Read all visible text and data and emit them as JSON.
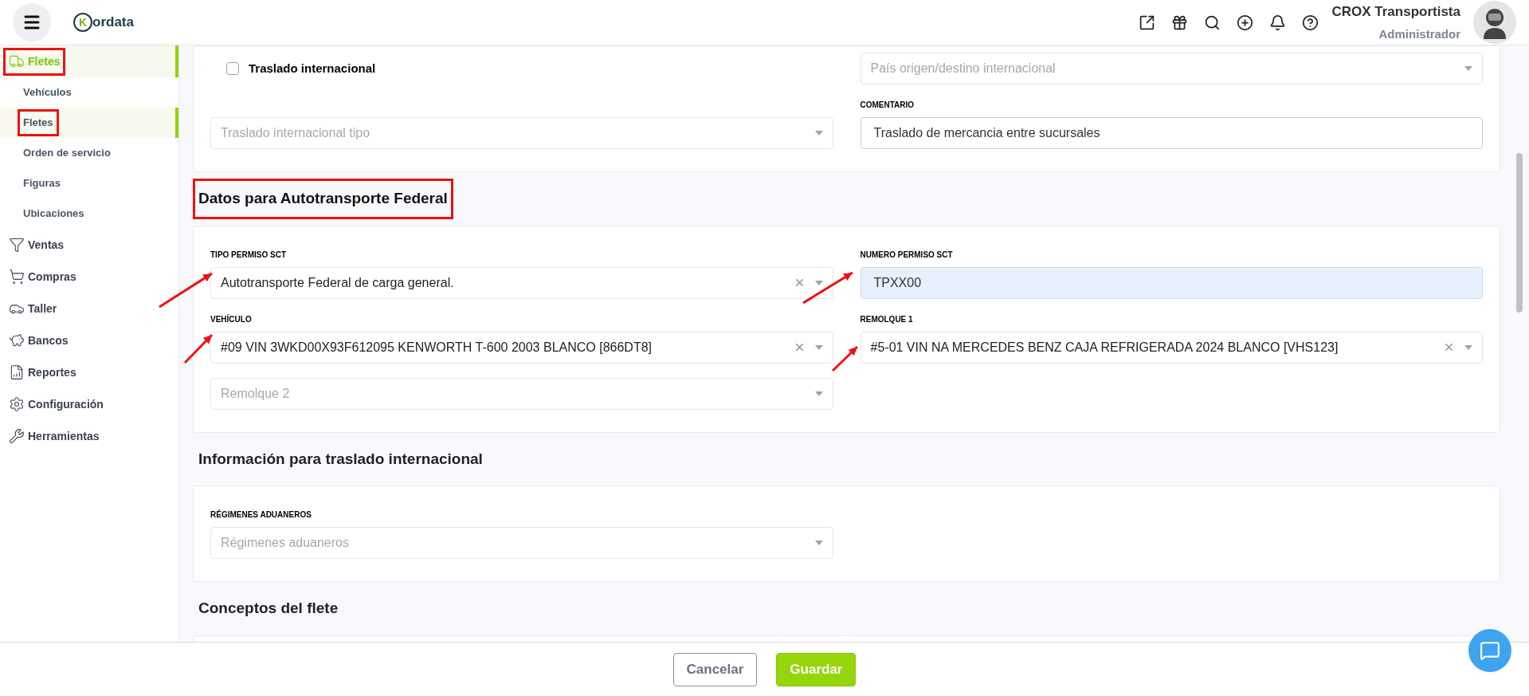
{
  "header": {
    "logo": {
      "mark": "K",
      "text": "ordata"
    },
    "user": {
      "name": "CROX Transportista",
      "role": "Administrador"
    }
  },
  "sidebar": {
    "items": [
      {
        "label": "Fletes",
        "selected": true,
        "highlighted": true,
        "children": [
          {
            "label": "Vehículos",
            "selected": false,
            "highlighted": false
          },
          {
            "label": "Fletes",
            "selected": true,
            "highlighted": true
          },
          {
            "label": "Orden de servicio",
            "selected": false,
            "highlighted": false
          },
          {
            "label": "Figuras",
            "selected": false,
            "highlighted": false
          },
          {
            "label": "Ubicaciones",
            "selected": false,
            "highlighted": false
          }
        ]
      },
      {
        "label": "Ventas",
        "selected": false,
        "highlighted": false
      },
      {
        "label": "Compras",
        "selected": false,
        "highlighted": false
      },
      {
        "label": "Taller",
        "selected": false,
        "highlighted": false
      },
      {
        "label": "Bancos",
        "selected": false,
        "highlighted": false
      },
      {
        "label": "Reportes",
        "selected": false,
        "highlighted": false
      },
      {
        "label": "Configuración",
        "selected": false,
        "highlighted": false
      },
      {
        "label": "Herramientas",
        "selected": false,
        "highlighted": false
      }
    ]
  },
  "sections": [
    {
      "fields": [
        {
          "kind": "checkbox",
          "label": "Traslado internacional",
          "checked": false
        },
        {
          "kind": "select",
          "placeholder": "País origen/destino internacional"
        },
        {
          "kind": "select",
          "placeholder": "Traslado internacional tipo"
        },
        {
          "kind": "text",
          "label": "COMENTARIO",
          "value": "Traslado de mercancia entre sucursales",
          "autofilled": false
        }
      ]
    },
    {
      "title": "Datos para Autotransporte Federal",
      "highlighted": true,
      "fields": [
        {
          "kind": "select",
          "label": "TIPO PERMISO SCT",
          "value": "Autotransporte Federal de carga general.",
          "clearable": true
        },
        {
          "kind": "text",
          "label": "NUMERO PERMISO SCT",
          "value": "TPXX00",
          "autofilled": true
        },
        {
          "kind": "select",
          "label": "VEHÍCULO",
          "value": "#09 VIN 3WKD00X93F612095 KENWORTH T-600 2003 BLANCO [866DT8]",
          "clearable": true
        },
        {
          "kind": "select",
          "label": "REMOLQUE 1",
          "value": "#5-01 VIN NA MERCEDES BENZ CAJA REFRIGERADA 2024 BLANCO [VHS123]",
          "clearable": true
        },
        {
          "kind": "select",
          "placeholder": "Remolque 2"
        }
      ]
    },
    {
      "title": "Información para traslado internacional",
      "highlighted": false,
      "fields": [
        {
          "kind": "select",
          "label": "RÉGIMENES ADUANEROS",
          "placeholder": "Régimenes aduaneros"
        }
      ]
    },
    {
      "title": "Conceptos del flete",
      "highlighted": false
    }
  ],
  "footer": {
    "buttons": [
      {
        "label": "Cancelar",
        "kind": "secondary"
      },
      {
        "label": "Guardar",
        "kind": "primary"
      }
    ]
  }
}
